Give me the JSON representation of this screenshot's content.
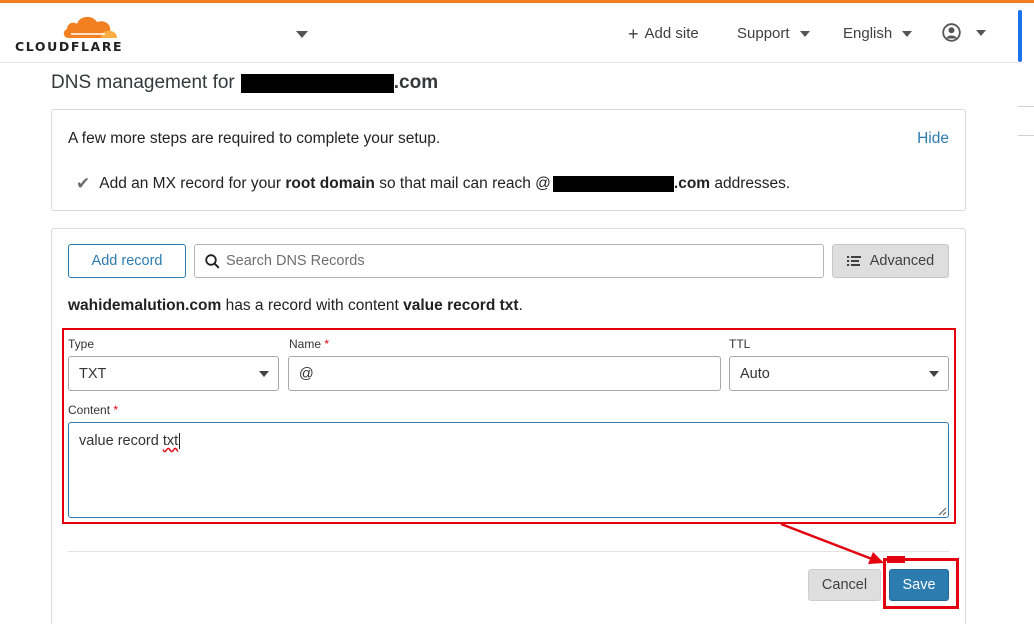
{
  "brand": {
    "name": "CLOUDFLARE",
    "accent": "#f38020",
    "logo_icon": "cloud-icon"
  },
  "nav": {
    "add_site": "Add site",
    "support": "Support",
    "language": "English",
    "user_icon": "user-circle-icon"
  },
  "page": {
    "title_prefix": "DNS management for",
    "title_suffix": ".com"
  },
  "setup": {
    "heading": "A few more steps are required to complete your setup.",
    "hide": "Hide",
    "step_prefix": "Add an MX record for your",
    "step_bold": "root domain",
    "step_middle": "so that mail can reach @",
    "step_domain_suffix": ".com",
    "step_suffix": "addresses."
  },
  "toolbar": {
    "add_record": "Add record",
    "search_placeholder": "Search DNS Records",
    "advanced": "Advanced"
  },
  "existing_record": {
    "domain": "wahidemalution.com",
    "middle": "has a record with content",
    "content": "value record txt",
    "end": "."
  },
  "form": {
    "type_label": "Type",
    "type_value": "TXT",
    "name_label": "Name",
    "name_value": "@",
    "ttl_label": "TTL",
    "ttl_value": "Auto",
    "content_label": "Content",
    "content_value_a": "value record ",
    "content_value_b": "txt",
    "required_mark": "*"
  },
  "actions": {
    "cancel": "Cancel",
    "save": "Save"
  },
  "annotation_color": "#e3000f",
  "link_color": "#2c7cb0"
}
